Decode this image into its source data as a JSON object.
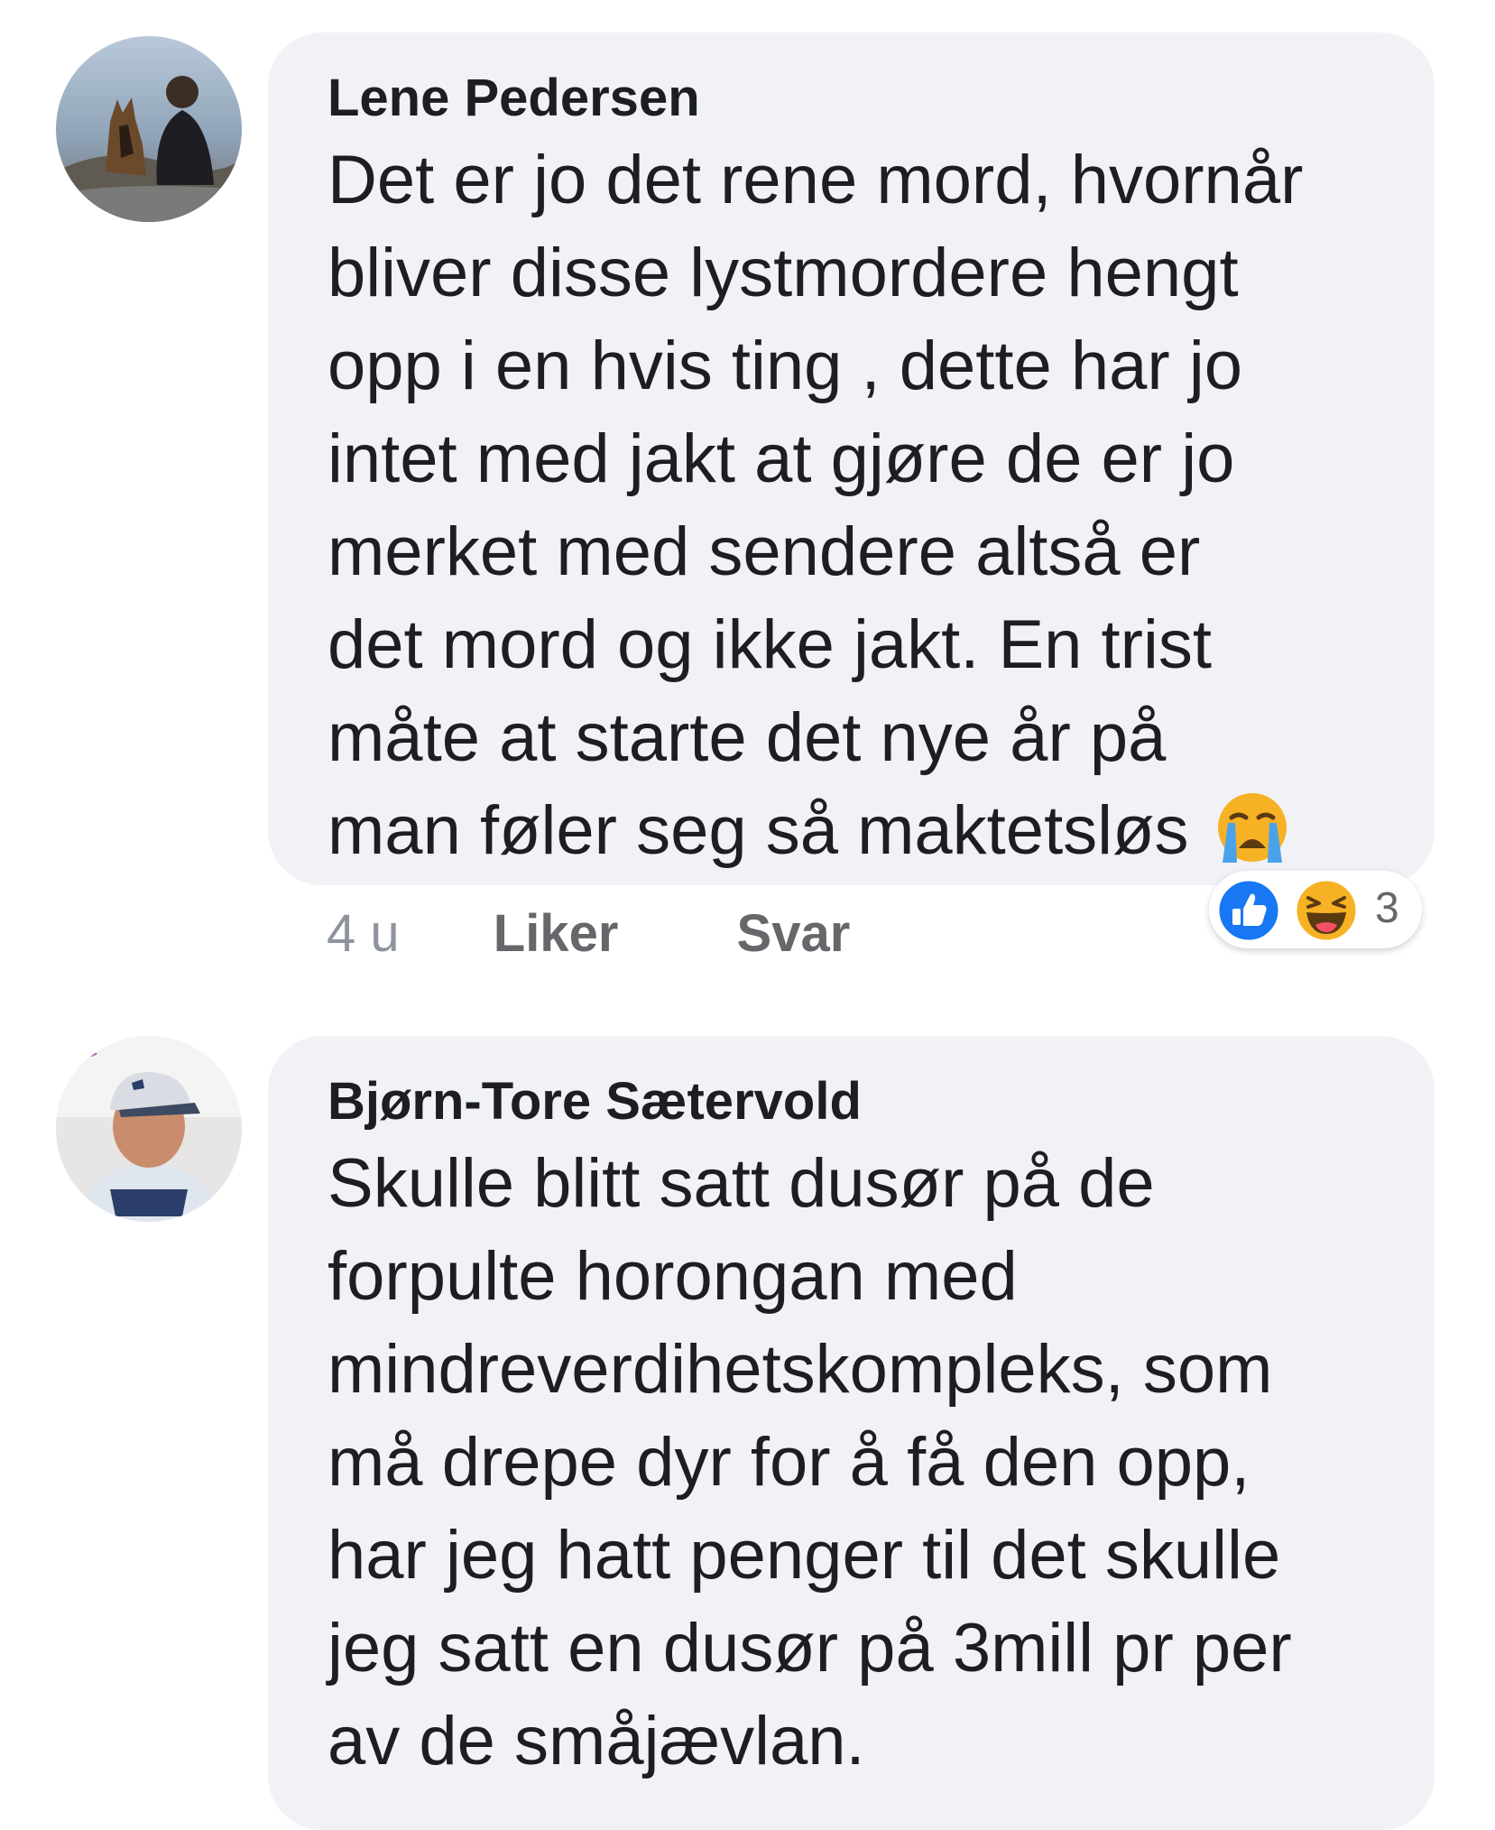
{
  "comments": [
    {
      "author": "Lene Pedersen",
      "text_lines": [
        "Det er jo det rene mord, hvornår",
        "bliver disse lystmordere hengt",
        "opp i en hvis ting , dette har jo",
        "intet med jakt at gjøre de er jo",
        "merket med sendere altså er",
        "det mord og ikke jakt. En trist",
        "måte at starte det nye år på",
        "man føler seg så maktetsløs"
      ],
      "trailing_emoji": "crying-face-icon",
      "time": "4 u",
      "like_label": "Liker",
      "reply_label": "Svar",
      "reaction_icons": [
        "like-reaction-icon",
        "haha-reaction-icon"
      ],
      "reaction_count": "3"
    },
    {
      "author": "Bjørn-Tore Sætervold",
      "text_lines": [
        "Skulle blitt satt dusør på de",
        "forpulte horongan med",
        "mindreverdihetskompleks, som",
        "må drepe dyr for å få den opp,",
        "har jeg hatt penger til det skulle",
        "jeg satt en dusør på 3mill pr per",
        "av de småjævlan."
      ]
    }
  ],
  "colors": {
    "bubble": "#f0f2f5",
    "like_blue": "#1877f2",
    "haha_yellow": "#f7b125",
    "meta_gray": "#65676b"
  }
}
